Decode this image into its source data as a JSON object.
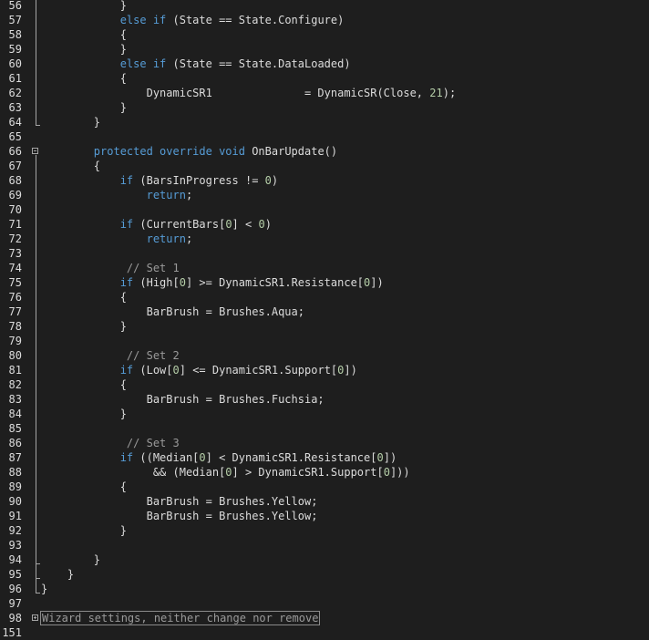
{
  "editor": {
    "lines": [
      {
        "n": "56",
        "tokens": [
          {
            "t": "            }"
          }
        ]
      },
      {
        "n": "57",
        "tokens": [
          {
            "t": "            "
          },
          {
            "t": "else if",
            "c": "kw"
          },
          {
            "t": " (State == State.Configure)"
          }
        ]
      },
      {
        "n": "58",
        "tokens": [
          {
            "t": "            {"
          }
        ]
      },
      {
        "n": "59",
        "tokens": [
          {
            "t": "            }"
          }
        ]
      },
      {
        "n": "60",
        "tokens": [
          {
            "t": "            "
          },
          {
            "t": "else if",
            "c": "kw"
          },
          {
            "t": " (State == State.DataLoaded)"
          }
        ]
      },
      {
        "n": "61",
        "tokens": [
          {
            "t": "            {"
          }
        ]
      },
      {
        "n": "62",
        "tokens": [
          {
            "t": "                DynamicSR1              = DynamicSR(Close, "
          },
          {
            "t": "21",
            "c": "num"
          },
          {
            "t": ");"
          }
        ]
      },
      {
        "n": "63",
        "tokens": [
          {
            "t": "            }"
          }
        ]
      },
      {
        "n": "64",
        "tokens": [
          {
            "t": "        }"
          }
        ]
      },
      {
        "n": "65",
        "tokens": [
          {
            "t": ""
          }
        ]
      },
      {
        "n": "66",
        "tokens": [
          {
            "t": "        "
          },
          {
            "t": "protected override void",
            "c": "kw"
          },
          {
            "t": " OnBarUpdate()"
          }
        ]
      },
      {
        "n": "67",
        "tokens": [
          {
            "t": "        {"
          }
        ]
      },
      {
        "n": "68",
        "tokens": [
          {
            "t": "            "
          },
          {
            "t": "if",
            "c": "kw"
          },
          {
            "t": " (BarsInProgress != "
          },
          {
            "t": "0",
            "c": "num"
          },
          {
            "t": ")"
          }
        ]
      },
      {
        "n": "69",
        "tokens": [
          {
            "t": "                "
          },
          {
            "t": "return",
            "c": "kw"
          },
          {
            "t": ";"
          }
        ]
      },
      {
        "n": "70",
        "tokens": [
          {
            "t": ""
          }
        ]
      },
      {
        "n": "71",
        "tokens": [
          {
            "t": "            "
          },
          {
            "t": "if",
            "c": "kw"
          },
          {
            "t": " (CurrentBars["
          },
          {
            "t": "0",
            "c": "num"
          },
          {
            "t": "] < "
          },
          {
            "t": "0",
            "c": "num"
          },
          {
            "t": ")"
          }
        ]
      },
      {
        "n": "72",
        "tokens": [
          {
            "t": "                "
          },
          {
            "t": "return",
            "c": "kw"
          },
          {
            "t": ";"
          }
        ]
      },
      {
        "n": "73",
        "tokens": [
          {
            "t": ""
          }
        ]
      },
      {
        "n": "74",
        "tokens": [
          {
            "t": "             "
          },
          {
            "t": "// Set 1",
            "c": "cm"
          }
        ]
      },
      {
        "n": "75",
        "tokens": [
          {
            "t": "            "
          },
          {
            "t": "if",
            "c": "kw"
          },
          {
            "t": " (High["
          },
          {
            "t": "0",
            "c": "num"
          },
          {
            "t": "] >= DynamicSR1.Resistance["
          },
          {
            "t": "0",
            "c": "num"
          },
          {
            "t": "])"
          }
        ]
      },
      {
        "n": "76",
        "tokens": [
          {
            "t": "            {"
          }
        ]
      },
      {
        "n": "77",
        "tokens": [
          {
            "t": "                BarBrush = Brushes.Aqua;"
          }
        ]
      },
      {
        "n": "78",
        "tokens": [
          {
            "t": "            }"
          }
        ]
      },
      {
        "n": "79",
        "tokens": [
          {
            "t": ""
          }
        ]
      },
      {
        "n": "80",
        "tokens": [
          {
            "t": "             "
          },
          {
            "t": "// Set 2",
            "c": "cm"
          }
        ]
      },
      {
        "n": "81",
        "tokens": [
          {
            "t": "            "
          },
          {
            "t": "if",
            "c": "kw"
          },
          {
            "t": " (Low["
          },
          {
            "t": "0",
            "c": "num"
          },
          {
            "t": "] <= DynamicSR1.Support["
          },
          {
            "t": "0",
            "c": "num"
          },
          {
            "t": "])"
          }
        ]
      },
      {
        "n": "82",
        "tokens": [
          {
            "t": "            {"
          }
        ]
      },
      {
        "n": "83",
        "tokens": [
          {
            "t": "                BarBrush = Brushes.Fuchsia;"
          }
        ]
      },
      {
        "n": "84",
        "tokens": [
          {
            "t": "            }"
          }
        ]
      },
      {
        "n": "85",
        "tokens": [
          {
            "t": ""
          }
        ]
      },
      {
        "n": "86",
        "tokens": [
          {
            "t": "             "
          },
          {
            "t": "// Set 3",
            "c": "cm"
          }
        ]
      },
      {
        "n": "87",
        "tokens": [
          {
            "t": "            "
          },
          {
            "t": "if",
            "c": "kw"
          },
          {
            "t": " ((Median["
          },
          {
            "t": "0",
            "c": "num"
          },
          {
            "t": "] < DynamicSR1.Resistance["
          },
          {
            "t": "0",
            "c": "num"
          },
          {
            "t": "])"
          }
        ]
      },
      {
        "n": "88",
        "tokens": [
          {
            "t": "                 && (Median["
          },
          {
            "t": "0",
            "c": "num"
          },
          {
            "t": "] > DynamicSR1.Support["
          },
          {
            "t": "0",
            "c": "num"
          },
          {
            "t": "]))"
          }
        ]
      },
      {
        "n": "89",
        "tokens": [
          {
            "t": "            {"
          }
        ]
      },
      {
        "n": "90",
        "tokens": [
          {
            "t": "                BarBrush = Brushes.Yellow;"
          }
        ]
      },
      {
        "n": "91",
        "tokens": [
          {
            "t": "                BarBrush = Brushes.Yellow;"
          }
        ]
      },
      {
        "n": "92",
        "tokens": [
          {
            "t": "            }"
          }
        ]
      },
      {
        "n": "93",
        "tokens": [
          {
            "t": ""
          }
        ]
      },
      {
        "n": "94",
        "tokens": [
          {
            "t": "        }"
          }
        ]
      },
      {
        "n": "95",
        "tokens": [
          {
            "t": "    }"
          }
        ]
      },
      {
        "n": "96",
        "tokens": [
          {
            "t": "}"
          }
        ]
      },
      {
        "n": "97",
        "tokens": [
          {
            "t": ""
          }
        ]
      },
      {
        "n": "98",
        "tokens": [
          {
            "t": "Wizard settings, neither change nor remove",
            "c": "collapsed"
          }
        ]
      },
      {
        "n": "151",
        "tokens": [
          {
            "t": ""
          }
        ]
      }
    ]
  },
  "colors": {
    "background": "#1e1e1e",
    "text": "#dcdcdc",
    "keyword": "#569cd6",
    "number": "#b5cea8",
    "comment": "#9a9a9a"
  }
}
